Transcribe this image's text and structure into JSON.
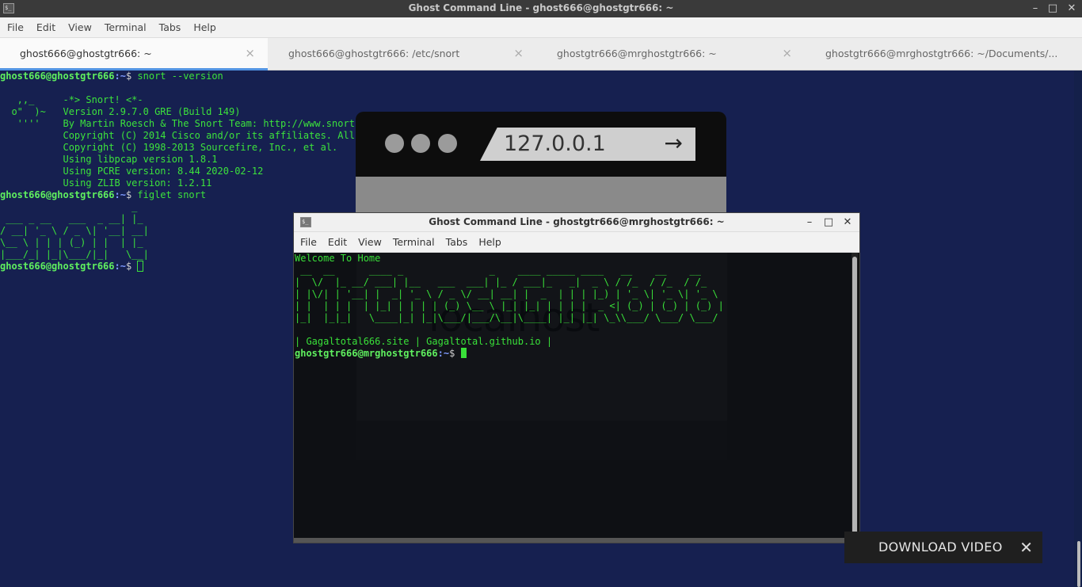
{
  "window": {
    "title": "Ghost Command Line - ghost666@ghostgtr666: ~",
    "icon_label": "$_",
    "controls": {
      "minimize": "–",
      "maximize": "□",
      "close": "✕"
    }
  },
  "menubar": [
    "File",
    "Edit",
    "View",
    "Terminal",
    "Tabs",
    "Help"
  ],
  "tabs": [
    {
      "label": "ghost666@ghostgtr666: ~",
      "active": true
    },
    {
      "label": "ghost666@ghostgtr666: /etc/snort",
      "active": false
    },
    {
      "label": "ghostgtr666@mrghostgtr666: ~",
      "active": false
    },
    {
      "label": "ghostgtr666@mrghostgtr666: ~/Documents/...",
      "active": false
    }
  ],
  "tab_close": "×",
  "prompt": {
    "user": "ghost666@ghostgtr666",
    "path": ":~",
    "dollar": "$ "
  },
  "terminal": {
    "cmd1": "snort --version",
    "snort_output": "\n   ,,_     -*> Snort! <*-\n  o\"  )~   Version 2.9.7.0 GRE (Build 149)\n   ''''    By Martin Roesch & The Snort Team: http://www.snort.org/contact#team\n           Copyright (C) 2014 Cisco and/or its affiliates. All rights reserved.\n           Copyright (C) 1998-2013 Sourcefire, Inc., et al.\n           Using libpcap version 1.8.1\n           Using PCRE version: 8.44 2020-02-12\n           Using ZLIB version: 1.2.11\n",
    "cmd2": "figlet snort",
    "figlet_output": "                       _\n ___ _ __   ___  _ __| |_\n/ __| '_ \\ / _ \\| '__| __|\n\\__ \\ | | | (_) | |  | |_\n|___/_| |_|\\___/|_|   \\__|\n"
  },
  "graphic": {
    "url": "127.0.0.1",
    "arrow": "→"
  },
  "float_window": {
    "title": "Ghost Command Line - ghostgtr666@mrghostgtr666: ~",
    "icon_label": "$_",
    "controls": {
      "minimize": "–",
      "maximize": "□",
      "close": "✕"
    },
    "menubar": [
      "File",
      "Edit",
      "View",
      "Terminal",
      "Tabs",
      "Help"
    ],
    "watermark": "localhost",
    "welcome": "Welcome To Home",
    "banner": " __  __      ____ _               _    ____ _____ ____   __    __    __\n|  \\/  |_ __/ ___| |__   ___  ___| |_ / ___|_   _|  _ \\ / /_  / /_  / /_\n| |\\/| | '__| |  _| '_ \\ / _ \\/ __| __| |  _  | | | |_) | '_ \\| '_ \\| '_ \\\n| |  | | |  | |_| | | | | (_) \\__ \\ |_| |_| | | | |  _ <| (_) | (_) | (_) |\n|_|  |_|_|   \\____|_| |_|\\___/|___/\\__|\\____| |_| |_| \\_\\\\___/ \\___/ \\___/",
    "sites": "| Gagaltotal666.site | Gagaltotal.github.io |",
    "prompt_user": "ghostgtr666@mrghostgtr666",
    "prompt_path": ":~",
    "prompt_dollar": "$ "
  },
  "download": {
    "label": "DOWNLOAD VIDEO",
    "close": "✕"
  }
}
